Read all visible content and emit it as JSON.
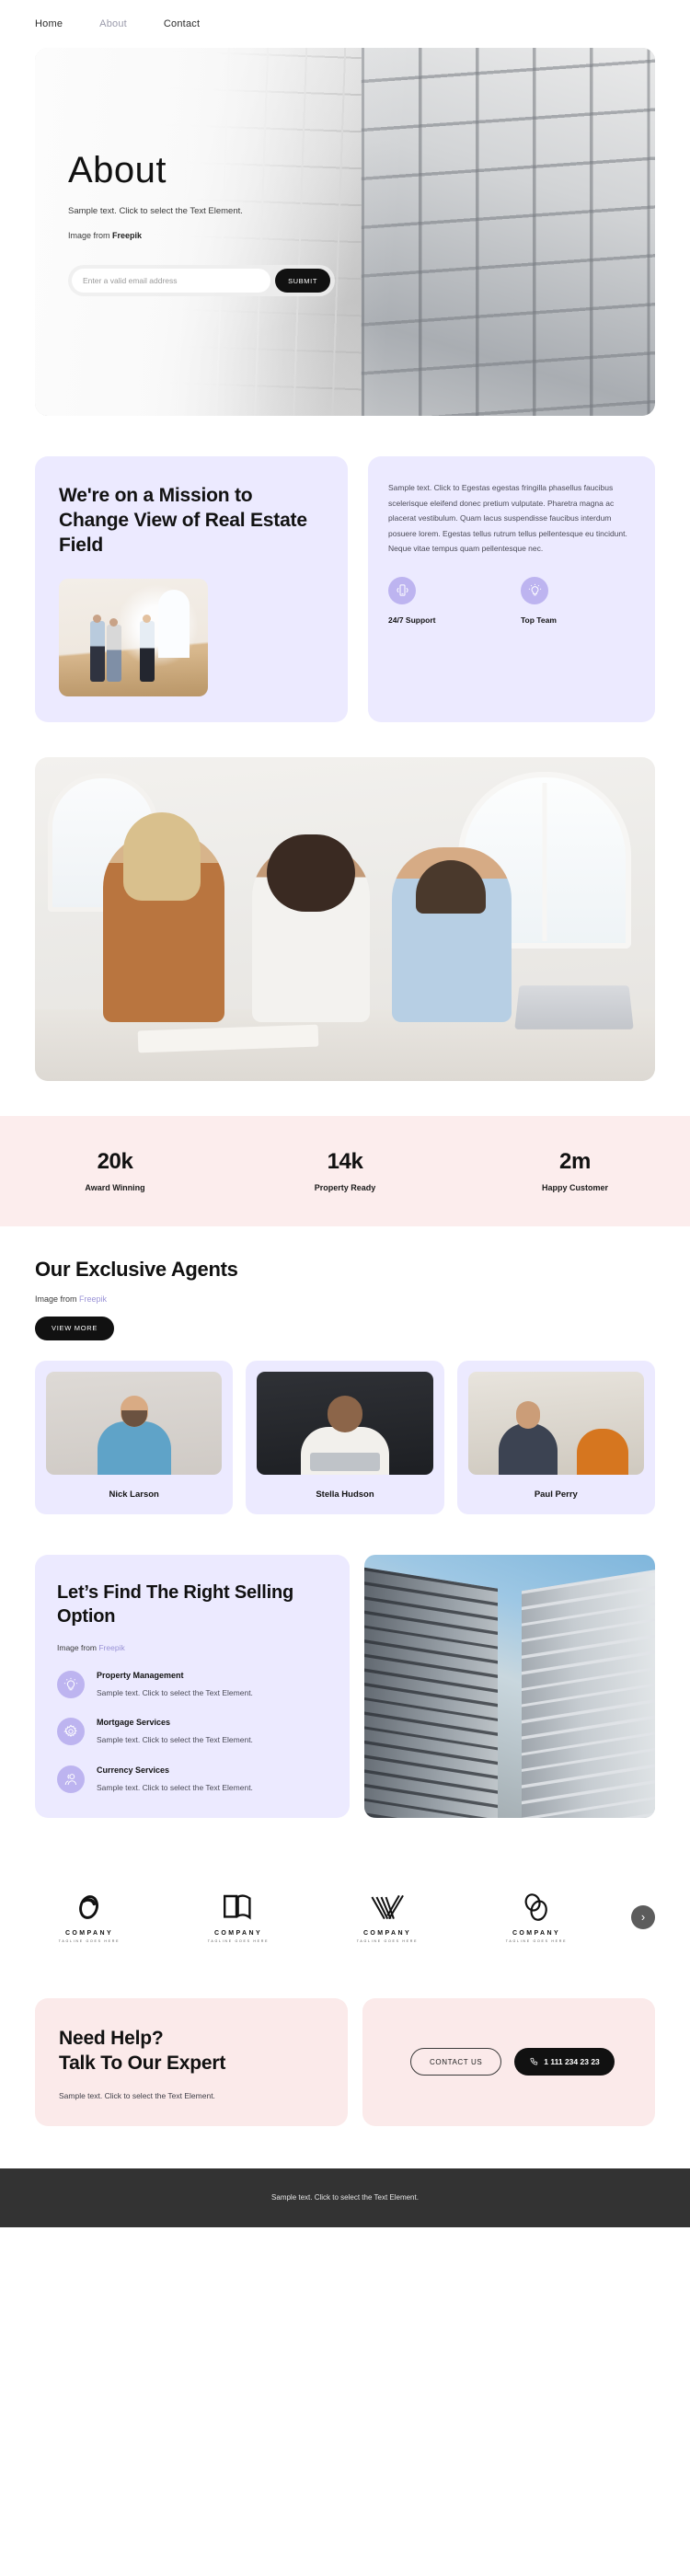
{
  "nav": {
    "items": [
      {
        "label": "Home",
        "active": false
      },
      {
        "label": "About",
        "active": true
      },
      {
        "label": "Contact",
        "active": false
      }
    ]
  },
  "hero": {
    "title": "About",
    "subtitle": "Sample text. Click to select the Text Element.",
    "credit_prefix": "Image from ",
    "credit_source": "Freepik",
    "form": {
      "placeholder": "Enter a valid email address",
      "value": "",
      "submit_label": "SUBMIT"
    }
  },
  "mission": {
    "title": "We're on a Mission to Change View of Real Estate Field",
    "body": "Sample text. Click to Egestas egestas fringilla phasellus faucibus scelerisque eleifend donec pretium vulputate. Pharetra magna ac placerat vestibulum. Quam lacus suspendisse faucibus interdum posuere lorem. Egestas tellus rutrum tellus pellentesque eu tincidunt. Neque vitae tempus quam pellentesque nec.",
    "features": [
      {
        "icon": "mobile-phone-icon",
        "label": "24/7 Support"
      },
      {
        "icon": "lightbulb-icon",
        "label": "Top Team"
      }
    ]
  },
  "stats": [
    {
      "value": "20k",
      "label": "Award Winning"
    },
    {
      "value": "14k",
      "label": "Property Ready"
    },
    {
      "value": "2m",
      "label": "Happy Customer"
    }
  ],
  "agents": {
    "title": "Our Exclusive Agents",
    "credit_prefix": "Image from ",
    "credit_source": "Freepik",
    "button_label": "VIEW MORE",
    "cards": [
      {
        "name": "Nick Larson"
      },
      {
        "name": "Stella Hudson"
      },
      {
        "name": "Paul Perry"
      }
    ]
  },
  "selling": {
    "title": "Let’s Find The Right Selling Option",
    "credit_prefix": "Image from ",
    "credit_source": "Freepik",
    "items": [
      {
        "icon": "lightbulb-icon",
        "name": "Property Management",
        "desc": "Sample text. Click to select the Text Element."
      },
      {
        "icon": "gear-icon",
        "name": "Mortgage Services",
        "desc": "Sample text. Click to select the Text Element."
      },
      {
        "icon": "users-icon",
        "name": "Currency Services",
        "desc": "Sample text. Click to select the Text Element."
      }
    ]
  },
  "logos": {
    "items": [
      {
        "mark": "ring-logo-icon",
        "name": "COMPANY",
        "tagline": "TAGLINE GOES HERE"
      },
      {
        "mark": "book-logo-icon",
        "name": "COMPANY",
        "tagline": "TAGLINE GOES HERE"
      },
      {
        "mark": "v-stripes-logo-icon",
        "name": "COMPANY",
        "tagline": "TAGLINE GOES HERE"
      },
      {
        "mark": "double-ring-logo-icon",
        "name": "COMPANY",
        "tagline": "TAGLINE GOES HERE"
      }
    ],
    "next_label": "›"
  },
  "cta": {
    "title": "Need Help?\nTalk To Our Expert",
    "subtitle": "Sample text. Click to select the Text Element.",
    "contact_label": "CONTACT US",
    "phone_label": "1 111 234 23 23"
  },
  "footer": {
    "text": "Sample text. Click to select the Text Element."
  },
  "colors": {
    "lavender_card": "#eceaff",
    "icon_circle": "#bdb4f0",
    "pink_band": "#fceded",
    "pink_card": "#fbeaea",
    "dark": "#111111",
    "footer_bg": "#333333",
    "link": "#9a93d6"
  }
}
